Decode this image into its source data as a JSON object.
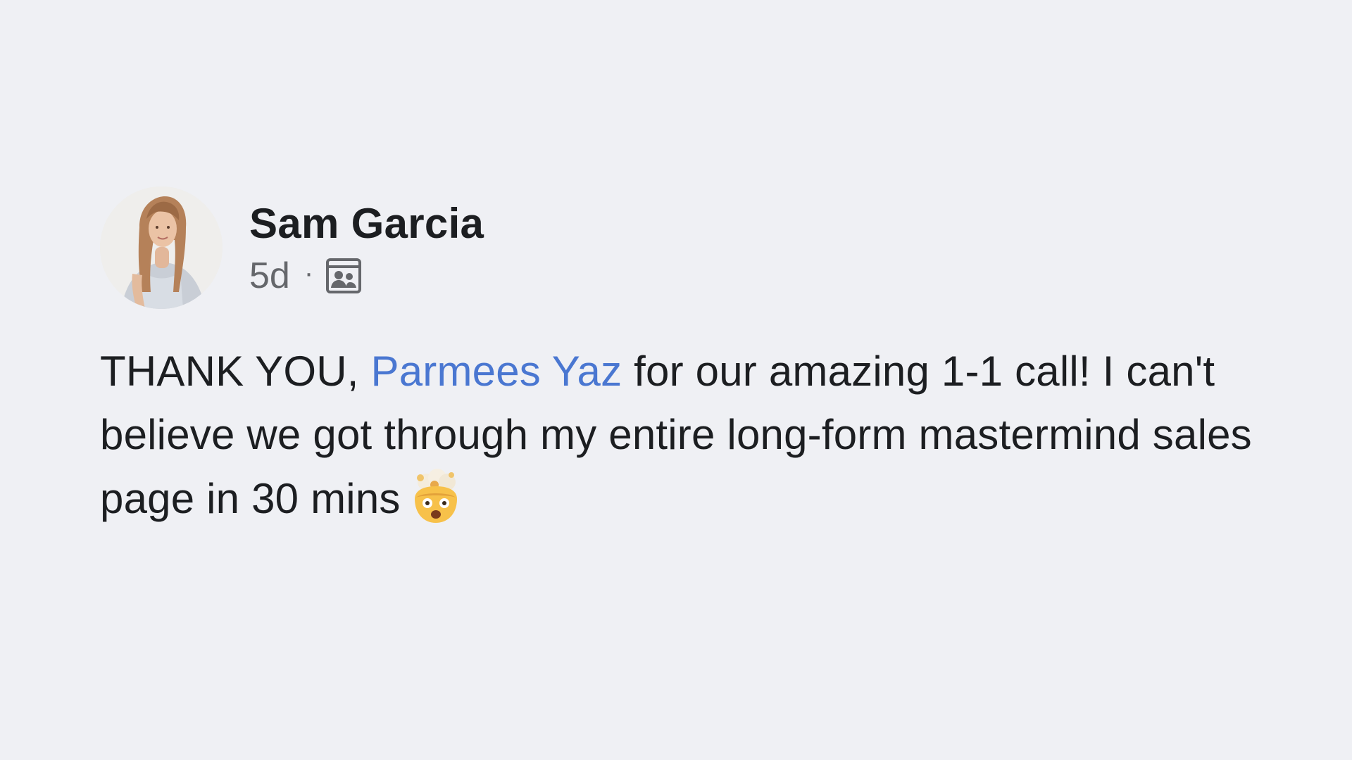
{
  "post": {
    "author": "Sam Garcia",
    "time": "5d",
    "separator": "·",
    "audience_icon": "group-audience-icon",
    "text_prefix": "THANK YOU, ",
    "mention": "Parmees Yaz",
    "text_suffix": " for our amazing 1-1 call! I can't believe we got through my entire long-form mastermind sales page in 30 mins",
    "emoji": "exploding-head-emoji"
  },
  "colors": {
    "background": "#eff0f4",
    "mention": "#4a77d1",
    "meta": "#65676b",
    "text": "#1c1e21"
  }
}
